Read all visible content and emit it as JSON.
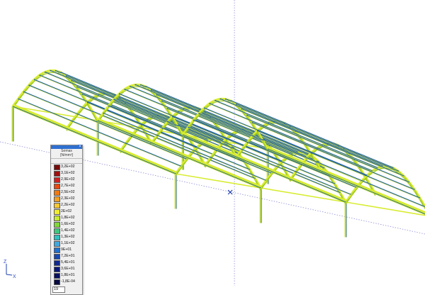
{
  "legend": {
    "title": "Sσmax",
    "unit": "[N/mm²]",
    "input_value": "19",
    "items": [
      {
        "label": "3,2E+02",
        "color": "#7a0a0a"
      },
      {
        "label": "3,1E+02",
        "color": "#a01010"
      },
      {
        "label": "2,9E+02",
        "color": "#d02020"
      },
      {
        "label": "2,7E+02",
        "color": "#e84a10"
      },
      {
        "label": "2,5E+02",
        "color": "#f07a10"
      },
      {
        "label": "2,3E+02",
        "color": "#f5a020"
      },
      {
        "label": "2,2E+02",
        "color": "#f8c830"
      },
      {
        "label": "2E+02",
        "color": "#f0ec30"
      },
      {
        "label": "1,8E+02",
        "color": "#c8e830"
      },
      {
        "label": "1,6E+02",
        "color": "#80d838"
      },
      {
        "label": "1,4E+02",
        "color": "#40c880"
      },
      {
        "label": "1,3E+02",
        "color": "#30c0c0"
      },
      {
        "label": "1,1E+02",
        "color": "#40a8e0"
      },
      {
        "label": "9E+01",
        "color": "#2070d0"
      },
      {
        "label": "7,2E+01",
        "color": "#1848b0"
      },
      {
        "label": "5,4E+01",
        "color": "#102890"
      },
      {
        "label": "3,6E+01",
        "color": "#0a1878"
      },
      {
        "label": "1,8E+01",
        "color": "#081060"
      },
      {
        "label": "-1,8E-04",
        "color": "#060a40"
      }
    ]
  },
  "axes": {
    "z_label": "Z",
    "x_label": "X"
  },
  "colors": {
    "member_yellow": "#d8ec30",
    "member_green": "#9ec820",
    "member_blue": "#1e5fa8",
    "grid_dot": "#8c8cd8",
    "column": "#c8e040"
  }
}
